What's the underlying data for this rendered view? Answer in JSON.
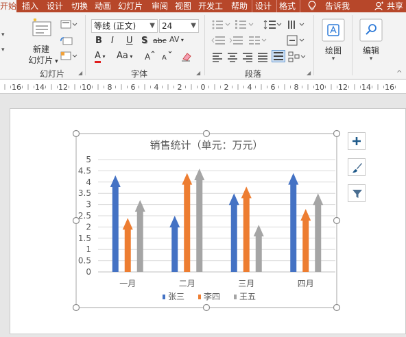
{
  "tabs": [
    {
      "label": "开始",
      "active": true
    },
    {
      "label": "插入"
    },
    {
      "label": "设计"
    },
    {
      "label": "切换"
    },
    {
      "label": "动画"
    },
    {
      "label": "幻灯片"
    },
    {
      "label": "审阅"
    },
    {
      "label": "视图"
    },
    {
      "label": "开发工"
    },
    {
      "label": "帮助"
    },
    {
      "label": "设计"
    },
    {
      "label": "格式"
    }
  ],
  "tell_me": "告诉我",
  "share": "共享",
  "ribbon": {
    "new_slide_line1": "新建",
    "new_slide_line2": "幻灯片",
    "group_slides": "幻灯片",
    "font_name": "等线 (正文)",
    "font_size": "24",
    "group_font": "字体",
    "group_paragraph": "段落",
    "draw": "绘图",
    "edit": "编辑",
    "bold": "B",
    "italic": "I",
    "underline": "U",
    "shadow": "S",
    "strike": "abc",
    "spacing": "AV",
    "font_color": "A",
    "font_size_change": "Aa"
  },
  "ruler_labels": [
    "16",
    "14",
    "12",
    "10",
    "8",
    "6",
    "4",
    "2",
    "0",
    "2",
    "4",
    "6",
    "8",
    "10",
    "12",
    "14",
    "16"
  ],
  "chart_data": {
    "type": "bar",
    "title": "销售统计（单元：万元）",
    "categories": [
      "一月",
      "二月",
      "三月",
      "四月"
    ],
    "ylim": [
      0,
      5
    ],
    "yticks": [
      "0",
      "0.5",
      "1",
      "1.5",
      "2",
      "2.5",
      "3",
      "3.5",
      "4",
      "4.5",
      "5"
    ],
    "series": [
      {
        "name": "张三",
        "color": "#4472c4",
        "values": [
          4.3,
          2.5,
          3.5,
          4.4
        ]
      },
      {
        "name": "李四",
        "color": "#ed7d31",
        "values": [
          2.4,
          4.4,
          3.8,
          2.8
        ]
      },
      {
        "name": "王五",
        "color": "#a5a5a5",
        "values": [
          3.2,
          4.6,
          2.1,
          3.5
        ]
      }
    ],
    "legend": "bottom",
    "grid": true
  },
  "side_buttons": [
    "plus-icon",
    "brush-icon",
    "filter-icon"
  ]
}
